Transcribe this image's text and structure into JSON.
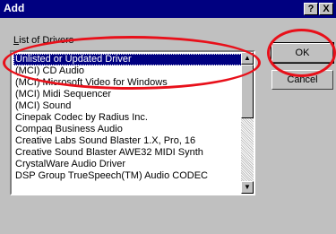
{
  "window": {
    "title": "Add",
    "help_button": "?",
    "close_button": "X"
  },
  "list": {
    "label_prefix": "L",
    "label_rest": "ist of Drivers",
    "items": [
      "Unlisted or Updated Driver",
      "(MCI) CD Audio",
      "(MCI) Microsoft Video for Windows",
      "(MCI) Midi Sequencer",
      "(MCI) Sound",
      "Cinepak Codec by Radius Inc.",
      "Compaq Business Audio",
      "Creative Labs Sound Blaster 1.X, Pro, 16",
      "Creative Sound Blaster AWE32 MIDI Synth",
      "CrystalWare Audio Driver",
      "DSP Group TrueSpeech(TM) Audio CODEC"
    ],
    "selected_index": 0
  },
  "buttons": {
    "ok": "OK",
    "cancel": "Cancel"
  },
  "colors": {
    "titlebar": "#000080",
    "selection": "#000080",
    "annotation": "#e8101a"
  },
  "icons": {
    "scroll_up": "up-arrow-icon",
    "scroll_down": "down-arrow-icon"
  }
}
